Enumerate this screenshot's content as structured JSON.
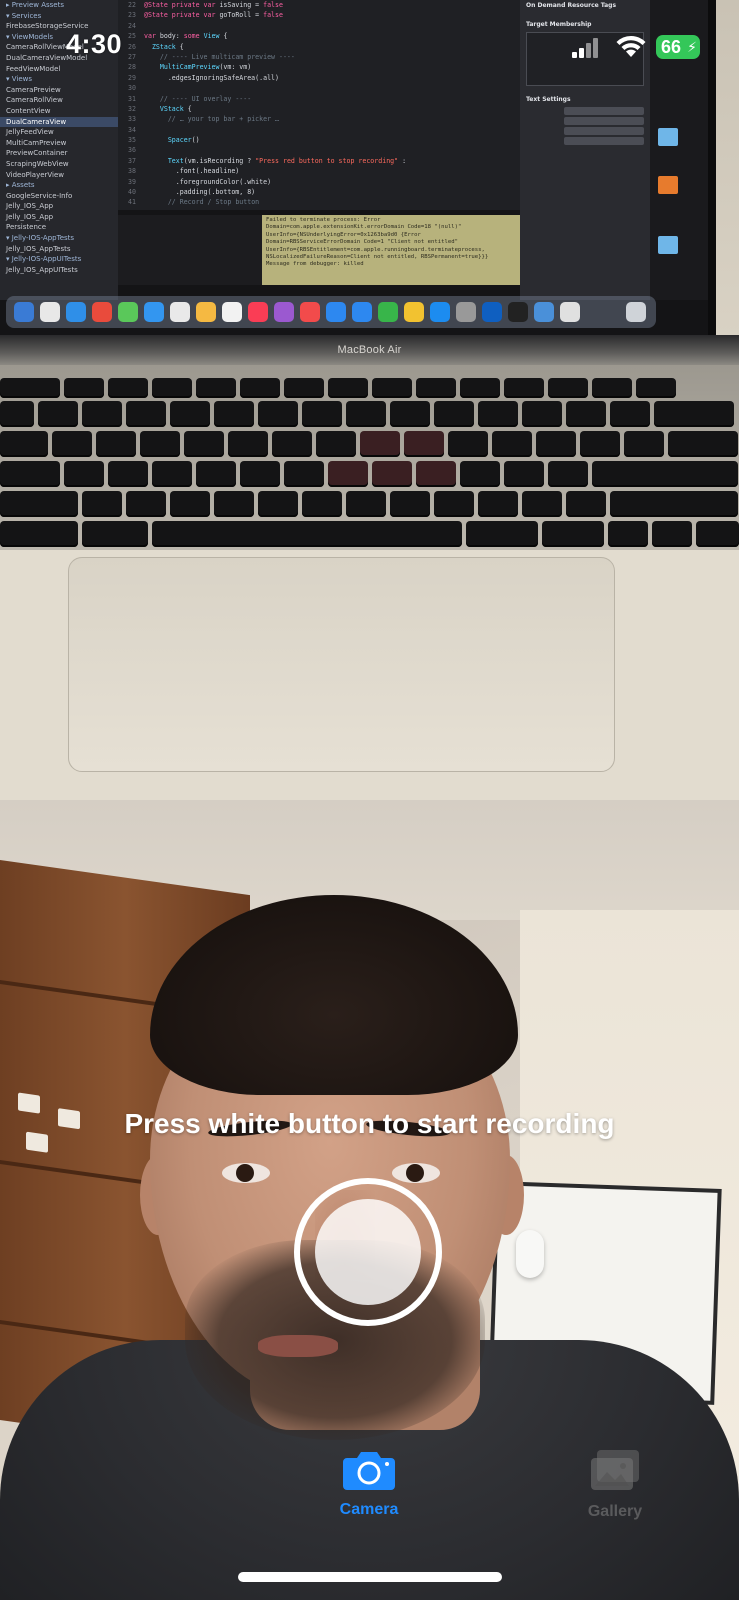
{
  "status_bar": {
    "time": "4:30",
    "battery_level": "66"
  },
  "background": {
    "laptop_brand_label": "MacBook Air"
  },
  "camera_overlay": {
    "prompt": "Press white button to start recording"
  },
  "tabbar": {
    "tabs": [
      {
        "label": "Camera",
        "icon": "camera-icon",
        "selected": true
      },
      {
        "label": "Gallery",
        "icon": "photo-gallery-icon",
        "selected": false
      }
    ]
  },
  "colors": {
    "accent": "#1f8bff",
    "battery": "#34c759",
    "shutter": "#ffffff"
  }
}
